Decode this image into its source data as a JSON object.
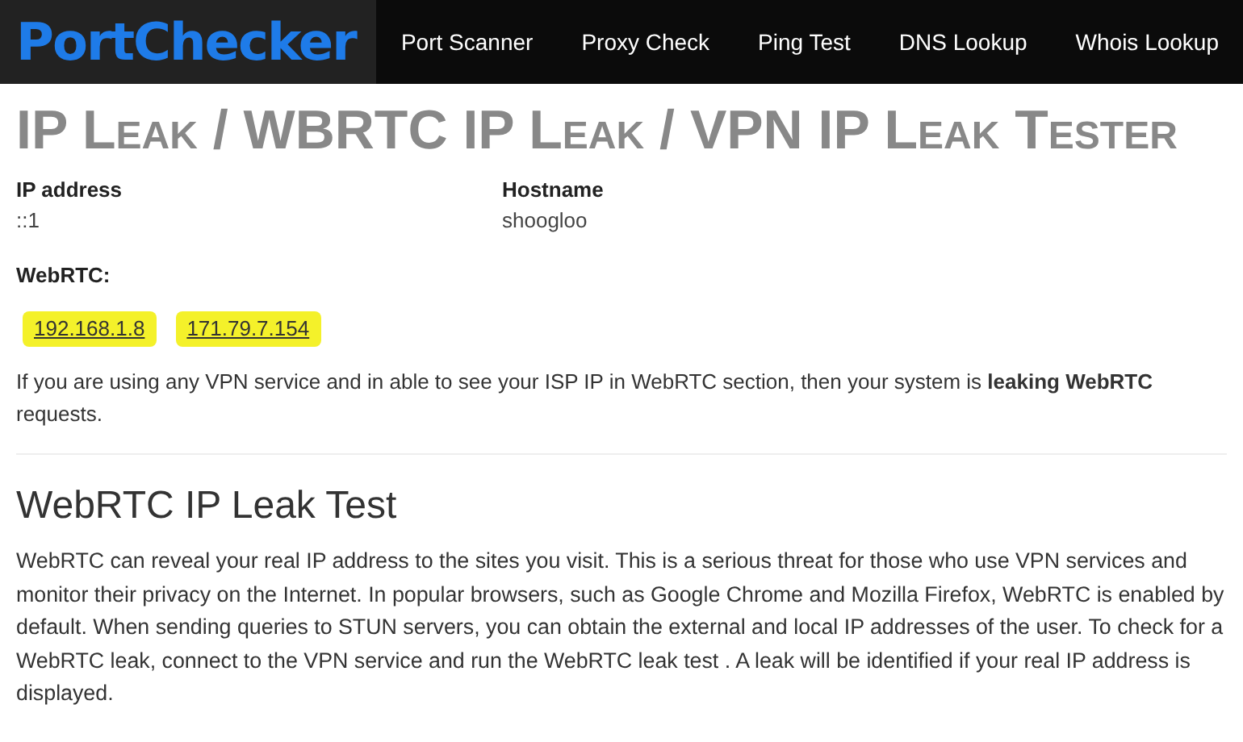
{
  "nav": {
    "logo": "PortChecker",
    "items": [
      "Port Scanner",
      "Proxy Check",
      "Ping Test",
      "DNS Lookup",
      "Whois Lookup"
    ]
  },
  "title": "IP Leak / WBRTC IP Leak / VPN IP Leak Tester",
  "info": [
    {
      "label": "IP address",
      "value": "::1"
    },
    {
      "label": "Hostname",
      "value": "shoogloo"
    }
  ],
  "webrtc": {
    "label": "WebRTC:",
    "ips": [
      {
        "text": "192.168.1.8",
        "highlighted": true
      },
      {
        "text": "171.79.7.154",
        "highlighted": true
      }
    ],
    "note": "If you are using any VPN service and in able to see your ISP IP in WebRTC section, then your system is **leaking WebRTC** requests."
  },
  "section": {
    "heading": "WebRTC IP Leak Test",
    "body": "WebRTC can reveal your real IP address to the sites you visit. This is a serious threat for those who use VPN services and monitor their privacy on the Internet. In popular browsers, such as Google Chrome and Mozilla Firefox, WebRTC is enabled by default. When sending queries to STUN servers, you can obtain the external and local IP addresses of the user. To check for a WebRTC leak, connect to the VPN service and run the WebRTC leak test . A leak will be identified if your real IP address is displayed."
  }
}
